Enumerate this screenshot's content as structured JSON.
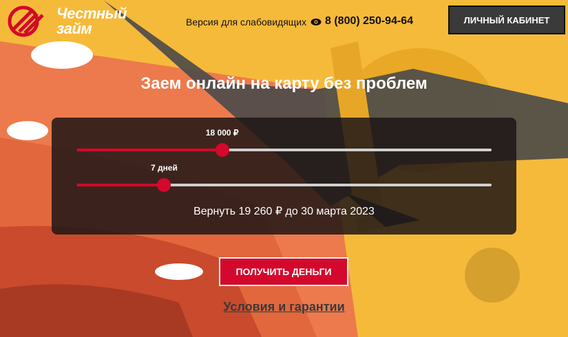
{
  "header": {
    "logo_text_line1": "Честный",
    "logo_text_line2": "займ",
    "accessibility_label": "Версия для слабовидящих",
    "phone": "8 (800) 250-94-64",
    "cabinet_label": "ЛИЧНЫЙ КАБИНЕТ"
  },
  "hero": {
    "headline": "Заем онлайн на карту без проблем"
  },
  "calculator": {
    "amount_value": "18 000 ₽",
    "amount_fraction": 0.35,
    "term_value": "7 дней",
    "term_fraction": 0.21,
    "summary": "Вернуть 19 260 ₽ до 30 марта 2023"
  },
  "actions": {
    "get_money_label": "ПОЛУЧИТЬ ДЕНЬГИ",
    "terms_link": "Условия и гарантии"
  },
  "colors": {
    "accent": "#d4082c",
    "background": "#f5b731"
  }
}
